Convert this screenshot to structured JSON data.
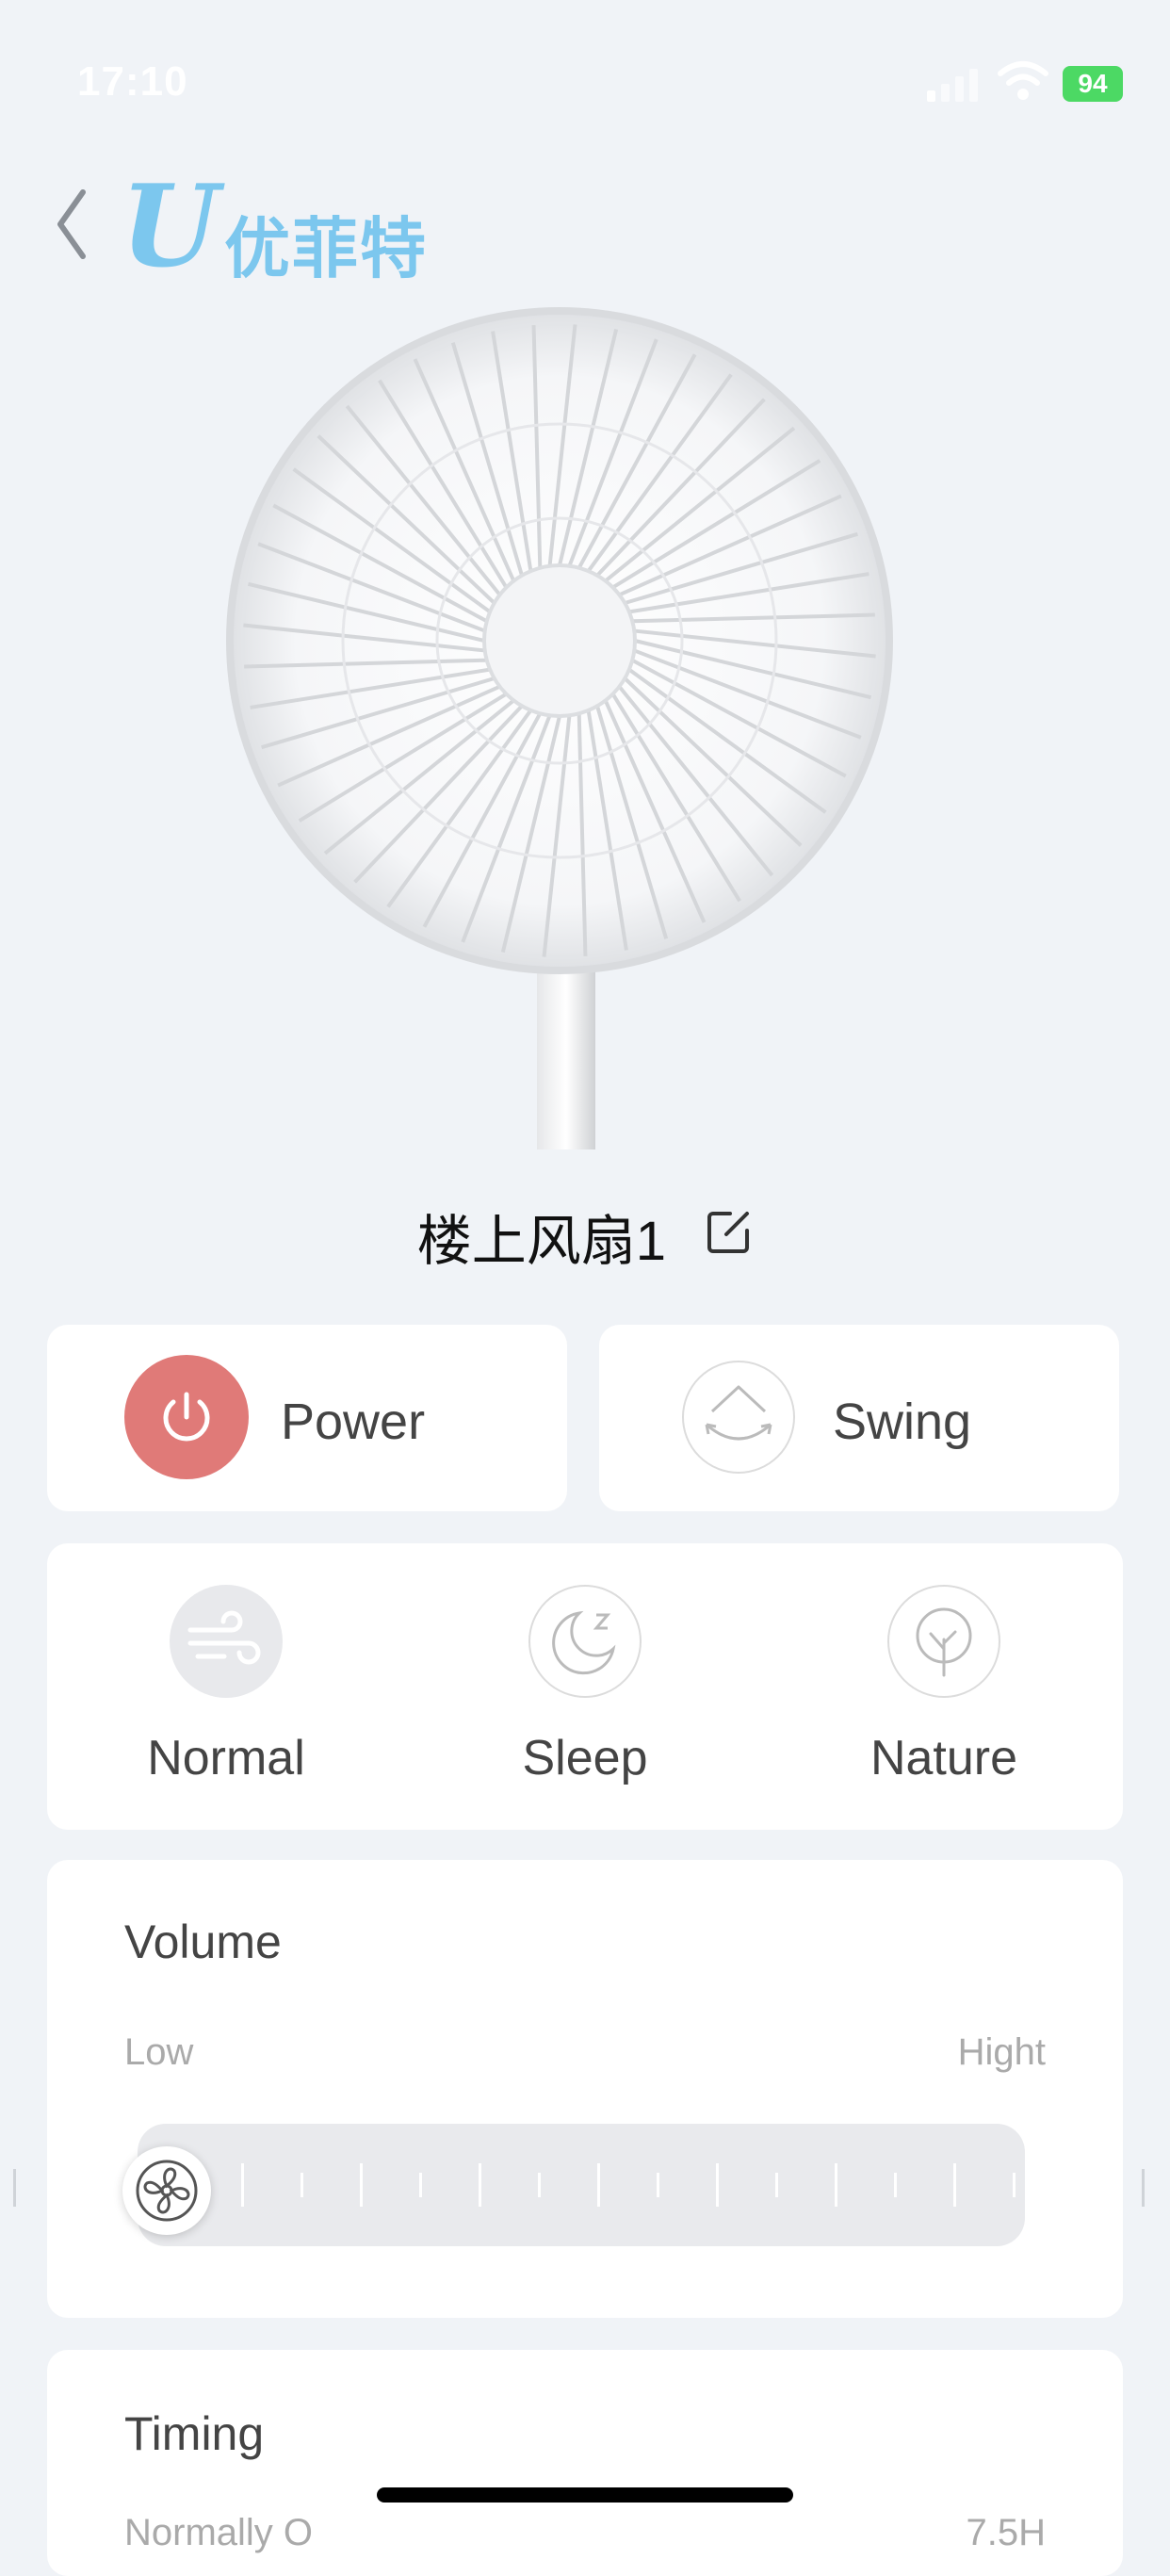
{
  "status_bar": {
    "time": "17:10",
    "battery": "94"
  },
  "header": {
    "logo_letter": "U",
    "logo_text": "优菲特"
  },
  "device": {
    "name": "楼上风扇1"
  },
  "controls": {
    "power_label": "Power",
    "swing_label": "Swing",
    "power_color": "#e07a78"
  },
  "modes": [
    {
      "label": "Normal",
      "icon": "wind-icon",
      "active": true
    },
    {
      "label": "Sleep",
      "icon": "moon-icon",
      "active": false
    },
    {
      "label": "Nature",
      "icon": "leaf-icon",
      "active": false
    }
  ],
  "volume": {
    "title": "Volume",
    "low_label": "Low",
    "high_label": "Hight",
    "level": 0
  },
  "timing": {
    "title": "Timing",
    "subtitle": "Normally O",
    "value": "7.5H"
  }
}
